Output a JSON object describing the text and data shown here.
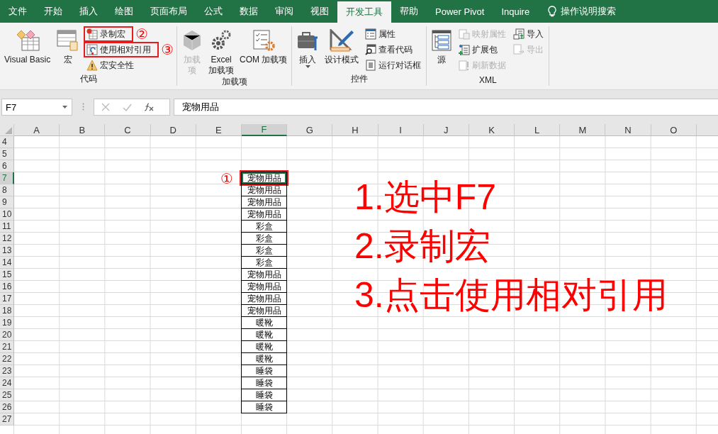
{
  "ribbon_tabs": [
    {
      "label": "文件",
      "selected": false
    },
    {
      "label": "开始",
      "selected": false
    },
    {
      "label": "插入",
      "selected": false
    },
    {
      "label": "绘图",
      "selected": false
    },
    {
      "label": "页面布局",
      "selected": false
    },
    {
      "label": "公式",
      "selected": false
    },
    {
      "label": "数据",
      "selected": false
    },
    {
      "label": "审阅",
      "selected": false
    },
    {
      "label": "视图",
      "selected": false
    },
    {
      "label": "开发工具",
      "selected": true
    },
    {
      "label": "帮助",
      "selected": false
    },
    {
      "label": "Power Pivot",
      "selected": false
    },
    {
      "label": "Inquire",
      "selected": false
    }
  ],
  "tell_me": "操作说明搜索",
  "ribbon_groups": [
    {
      "label": "代码",
      "columns": [
        [
          {
            "kind": "large",
            "label": "Visual Basic",
            "disabled": false
          }
        ],
        [
          {
            "kind": "large",
            "label": "宏",
            "disabled": false
          }
        ],
        [
          {
            "kind": "small",
            "label": "录制宏",
            "disabled": false,
            "highlighted": true,
            "badge": "②"
          },
          {
            "kind": "small",
            "label": "使用相对引用",
            "disabled": false,
            "highlighted": true,
            "badge": "③"
          },
          {
            "kind": "small",
            "label": "宏安全性",
            "disabled": false,
            "highlighted": false
          }
        ]
      ]
    },
    {
      "label": "加载项",
      "columns": [
        [
          {
            "kind": "large",
            "label": "加载项",
            "disabled": true
          }
        ],
        [
          {
            "kind": "large",
            "label": "Excel\n加载项",
            "disabled": false
          }
        ],
        [
          {
            "kind": "large",
            "label": "COM 加载项",
            "disabled": false
          }
        ]
      ]
    },
    {
      "label": "控件",
      "columns": [
        [
          {
            "kind": "dropdown",
            "label": "插入",
            "disabled": false
          }
        ],
        [
          {
            "kind": "large",
            "label": "设计模式",
            "disabled": false
          }
        ],
        [
          {
            "kind": "small",
            "label": "属性",
            "disabled": false,
            "highlighted": false
          },
          {
            "kind": "small",
            "label": "查看代码",
            "disabled": false,
            "highlighted": false
          },
          {
            "kind": "small",
            "label": "运行对话框",
            "disabled": false,
            "highlighted": false
          }
        ]
      ]
    },
    {
      "label": "XML",
      "columns": [
        [
          {
            "kind": "large",
            "label": "源",
            "disabled": false
          }
        ],
        [
          {
            "kind": "small",
            "label": "映射属性",
            "disabled": true,
            "highlighted": false
          },
          {
            "kind": "small",
            "label": "扩展包",
            "disabled": false,
            "highlighted": false
          },
          {
            "kind": "small",
            "label": "刷新数据",
            "disabled": true,
            "highlighted": false
          }
        ],
        [
          {
            "kind": "small",
            "label": "导入",
            "disabled": false,
            "highlighted": false
          },
          {
            "kind": "small",
            "label": "导出",
            "disabled": true,
            "highlighted": false
          }
        ]
      ]
    }
  ],
  "name_box": "F7",
  "formula": "宠物用品",
  "columns": [
    {
      "label": "A",
      "selected": false
    },
    {
      "label": "B",
      "selected": false
    },
    {
      "label": "C",
      "selected": false
    },
    {
      "label": "D",
      "selected": false
    },
    {
      "label": "E",
      "selected": false
    },
    {
      "label": "F",
      "selected": true
    },
    {
      "label": "G",
      "selected": false
    },
    {
      "label": "H",
      "selected": false
    },
    {
      "label": "I",
      "selected": false
    },
    {
      "label": "J",
      "selected": false
    },
    {
      "label": "K",
      "selected": false
    },
    {
      "label": "L",
      "selected": false
    },
    {
      "label": "M",
      "selected": false
    },
    {
      "label": "N",
      "selected": false
    },
    {
      "label": "O",
      "selected": false
    }
  ],
  "rows": [
    {
      "label": "4",
      "selected": false
    },
    {
      "label": "5",
      "selected": false
    },
    {
      "label": "6",
      "selected": false
    },
    {
      "label": "7",
      "selected": true,
      "f": "宠物用品"
    },
    {
      "label": "8",
      "selected": false,
      "f": "宠物用品"
    },
    {
      "label": "9",
      "selected": false,
      "f": "宠物用品"
    },
    {
      "label": "10",
      "selected": false,
      "f": "宠物用品"
    },
    {
      "label": "11",
      "selected": false,
      "f": "彩盒"
    },
    {
      "label": "12",
      "selected": false,
      "f": "彩盒"
    },
    {
      "label": "13",
      "selected": false,
      "f": "彩盒"
    },
    {
      "label": "14",
      "selected": false,
      "f": "彩盒"
    },
    {
      "label": "15",
      "selected": false,
      "f": "宠物用品"
    },
    {
      "label": "16",
      "selected": false,
      "f": "宠物用品"
    },
    {
      "label": "17",
      "selected": false,
      "f": "宠物用品"
    },
    {
      "label": "18",
      "selected": false,
      "f": "宠物用品"
    },
    {
      "label": "19",
      "selected": false,
      "f": "暖靴"
    },
    {
      "label": "20",
      "selected": false,
      "f": "暖靴"
    },
    {
      "label": "21",
      "selected": false,
      "f": "暖靴"
    },
    {
      "label": "22",
      "selected": false,
      "f": "暖靴"
    },
    {
      "label": "23",
      "selected": false,
      "f": "睡袋"
    },
    {
      "label": "24",
      "selected": false,
      "f": "睡袋"
    },
    {
      "label": "25",
      "selected": false,
      "f": "睡袋"
    },
    {
      "label": "26",
      "selected": false,
      "f": "睡袋"
    },
    {
      "label": "27",
      "selected": false
    }
  ],
  "cell_marker": "①",
  "instructions": [
    "1.选中F7",
    "2.录制宏",
    "3.点击使用相对引用"
  ]
}
